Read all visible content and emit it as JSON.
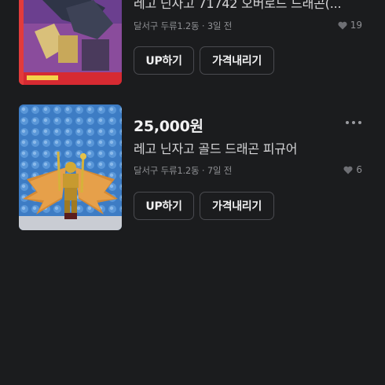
{
  "listings": [
    {
      "title": "레고 닌자고 71742 오버로드 드래곤(...",
      "location": "달서구 두류1.2동",
      "time": "3일 전",
      "likes": "19",
      "buttons": {
        "up": "UP하기",
        "price_down": "가격내리기"
      }
    },
    {
      "price": "25,000원",
      "title": "레고 닌자고 골드 드래곤 피규어",
      "location": "달서구 두류1.2동",
      "time": "7일 전",
      "likes": "6",
      "buttons": {
        "up": "UP하기",
        "price_down": "가격내리기"
      }
    }
  ],
  "separator": " · "
}
